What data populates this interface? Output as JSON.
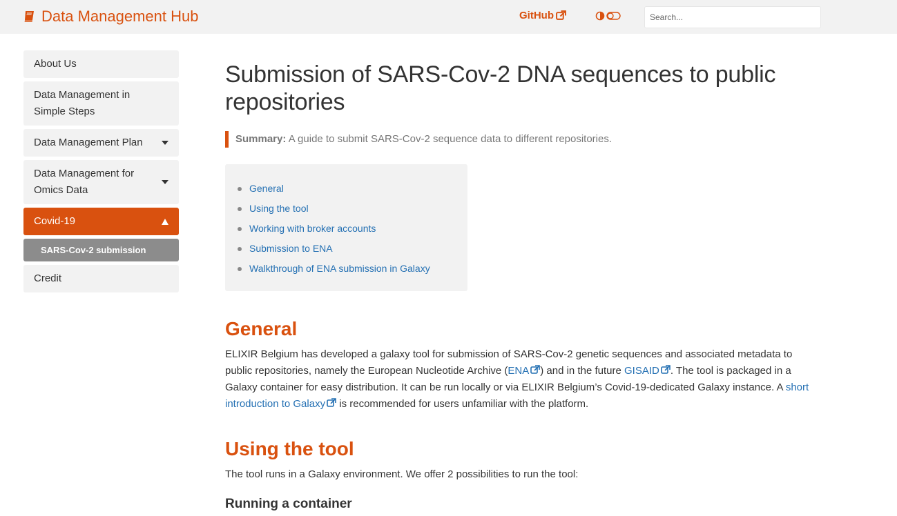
{
  "brand": {
    "title": "Data Management Hub",
    "icon": "book-icon",
    "color": "#d9510f"
  },
  "topnav": {
    "github_label": "GitHub",
    "github_icon": "external-link-icon",
    "theme_icon": "contrast-toggle-icon",
    "search_placeholder": "Search..."
  },
  "sidebar": {
    "items": [
      {
        "label": "About Us"
      },
      {
        "label": "Data Management in Simple Steps"
      },
      {
        "label": "Data Management Plan"
      },
      {
        "label": "Data Management for Omics Data"
      },
      {
        "label": "Covid-19"
      },
      {
        "label": "Credit"
      }
    ],
    "sub_items": [
      {
        "label": "SARS-Cov-2 submission"
      }
    ]
  },
  "main": {
    "title": "Submission of SARS-Cov-2 DNA sequences to public repositories",
    "summary_label": "Summary:",
    "summary_text": "A guide to submit SARS-Cov-2 sequence data to different repositories.",
    "toc": [
      {
        "label": "General"
      },
      {
        "label": "Using the tool"
      },
      {
        "label": "Working with broker accounts"
      },
      {
        "label": "Submission to ENA"
      },
      {
        "label": "Walkthrough of ENA submission in Galaxy"
      }
    ],
    "general": {
      "heading": "General",
      "p_part1": "ELIXIR Belgium has developed a galaxy tool for submission of SARS-Cov-2 genetic sequences and associated metadata to public repositories, namely the European Nucleotide Archive (",
      "link_ena": "ENA",
      "p_part2": ") and in the future ",
      "link_gisaid": "GISAID",
      "p_part3": ". The tool is packaged in a Galaxy container for easy distribution. It can be run locally or via ELIXIR Belgium’s Covid-19-dedicated Galaxy instance. A ",
      "link_galaxy": "short introduction to Galaxy",
      "p_part4": " is recommended for users unfamiliar with the platform."
    },
    "using_tool": {
      "heading": "Using the tool",
      "text": "The tool runs in a Galaxy environment. We offer 2 possibilities to run the tool:",
      "subheading": "Running a container"
    }
  },
  "colors": {
    "accent": "#d9510f",
    "link": "#2470b3",
    "sidebar_bg": "#f2f2f2",
    "sub_bg": "#8c8c8c"
  }
}
